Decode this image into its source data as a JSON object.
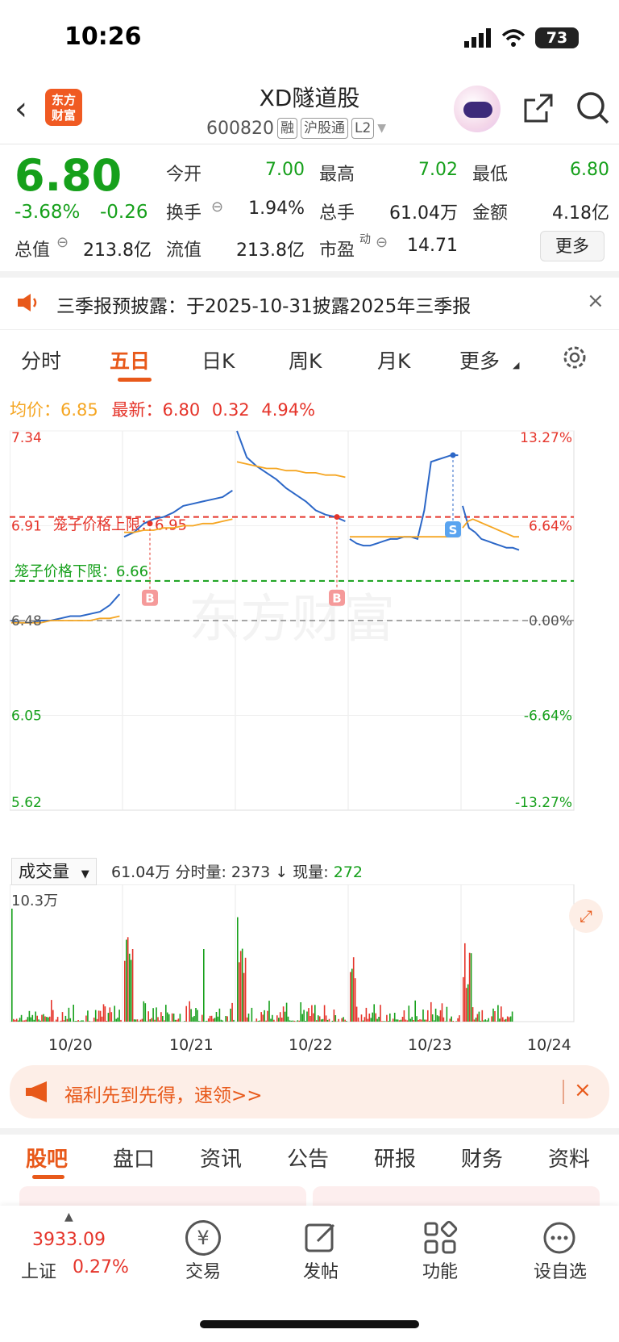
{
  "status": {
    "time": "10:26",
    "battery": "73"
  },
  "header": {
    "title": "XD隧道股",
    "code": "600820",
    "tags": [
      "融",
      "沪股通",
      "L2"
    ],
    "logo_text": "东方财富"
  },
  "quote": {
    "price": "6.80",
    "change_pct": "-3.68%",
    "change": "-0.26",
    "rows": [
      [
        {
          "label": "今开",
          "value": "7.00",
          "color": "green"
        },
        {
          "label": "最高",
          "value": "7.02",
          "color": "green"
        },
        {
          "label": "最低",
          "value": "6.80",
          "color": "green"
        }
      ],
      [
        {
          "label": "换手",
          "value": "1.94%",
          "color": "black"
        },
        {
          "label": "总手",
          "value": "61.04万",
          "color": "black"
        },
        {
          "label": "金额",
          "value": "4.18亿",
          "color": "black"
        }
      ],
      [
        {
          "label": "总值",
          "value": "213.8亿",
          "color": "black"
        },
        {
          "label": "流值",
          "value": "213.8亿",
          "color": "black"
        },
        {
          "label": "市盈",
          "value": "14.71",
          "color": "black"
        }
      ]
    ],
    "pe_sup": "动",
    "more_label": "更多"
  },
  "notice": {
    "text": "三季报预披露：于2025-10-31披露2025年三季报",
    "close": "×"
  },
  "tabs": {
    "items": [
      "分时",
      "五日",
      "日K",
      "周K",
      "月K",
      "更多"
    ],
    "active": 1
  },
  "legend": {
    "avg_label": "均价：",
    "avg_value": "6.85",
    "latest_label": "最新：",
    "latest_value": "6.80",
    "latest_chg": "0.32",
    "latest_pct": "4.94%"
  },
  "chart_data": {
    "type": "line",
    "title": "",
    "x": [
      "10/20",
      "10/21",
      "10/22",
      "10/23",
      "10/24"
    ],
    "xlabel": "",
    "ylabel": "",
    "ylim": [
      5.62,
      7.34
    ],
    "left_ticks": [
      "7.34",
      "6.91",
      "6.48",
      "6.05",
      "5.62"
    ],
    "right_ticks": [
      "13.27%",
      "6.64%",
      "0.00%",
      "-6.64%",
      "-13.27%"
    ],
    "reference_lines": [
      {
        "label": "笼子价格上限：6.95",
        "value": 6.95,
        "color": "#e5342a"
      },
      {
        "label": "笼子价格下限：6.66",
        "value": 6.66,
        "color": "#16a01b"
      },
      {
        "label": "",
        "value": 6.48,
        "color": "#888888"
      }
    ],
    "markers": [
      {
        "label": "B",
        "day": 1,
        "price": 6.92
      },
      {
        "label": "B",
        "day": 3,
        "price": 6.95
      },
      {
        "label": "S",
        "day": 4,
        "price": 7.23
      }
    ],
    "series": [
      {
        "name": "价格",
        "color": "#2c67c7",
        "days": [
          [
            6.48,
            6.47,
            6.47,
            6.48,
            6.48,
            6.49,
            6.5,
            6.5,
            6.51,
            6.52,
            6.55,
            6.6
          ],
          [
            6.86,
            6.88,
            6.92,
            6.94,
            6.95,
            6.97,
            7.0,
            7.01,
            7.02,
            7.03,
            7.04,
            7.07
          ],
          [
            7.34,
            7.22,
            7.18,
            7.15,
            7.12,
            7.08,
            7.05,
            7.02,
            6.98,
            6.96,
            6.95,
            6.93
          ],
          [
            6.85,
            6.83,
            6.82,
            6.82,
            6.83,
            6.84,
            6.85,
            6.85,
            6.86,
            6.86,
            6.85,
            6.98,
            7.2,
            7.21,
            7.22,
            7.23,
            7.23
          ],
          [
            7.0,
            6.9,
            6.88,
            6.85,
            6.84,
            6.83,
            6.82,
            6.81,
            6.81,
            6.8
          ]
        ]
      },
      {
        "name": "均价",
        "color": "#f5a623",
        "days": [
          [
            6.47,
            6.47,
            6.47,
            6.47,
            6.48,
            6.48,
            6.48,
            6.48,
            6.48,
            6.49,
            6.49,
            6.5
          ],
          [
            6.88,
            6.88,
            6.89,
            6.89,
            6.9,
            6.9,
            6.91,
            6.91,
            6.92,
            6.92,
            6.93,
            6.94
          ],
          [
            7.2,
            7.19,
            7.18,
            7.17,
            7.17,
            7.16,
            7.16,
            7.15,
            7.15,
            7.14,
            7.14,
            7.13
          ],
          [
            6.86,
            6.86,
            6.86,
            6.86,
            6.86,
            6.86,
            6.86,
            6.86,
            6.86,
            6.86,
            6.86,
            6.86
          ],
          [
            6.9,
            6.93,
            6.94,
            6.93,
            6.92,
            6.91,
            6.9,
            6.89,
            6.88,
            6.87,
            6.86,
            6.86
          ]
        ]
      }
    ]
  },
  "volume": {
    "selector": "成交量",
    "total": "61.04万",
    "tick_label": "分时量:",
    "tick_value": "2373",
    "arrow": "↓",
    "now_label": "现量:",
    "now_value": "272",
    "max_label": "10.3万",
    "expand_icon": "expand-icon"
  },
  "dates": [
    "10/20",
    "10/21",
    "10/22",
    "10/23",
    "10/24"
  ],
  "promo": {
    "text": "福利先到先得，速领>>",
    "close": "×"
  },
  "bottom_tabs": {
    "items": [
      "股吧",
      "盘口",
      "资讯",
      "公告",
      "研报",
      "财务",
      "资料"
    ],
    "active": 0
  },
  "footer": {
    "index_value": "3933.09",
    "index_name": "上证",
    "index_pct": "0.27%",
    "items": [
      {
        "label": "交易",
        "icon": "yen-icon"
      },
      {
        "label": "发帖",
        "icon": "edit-icon"
      },
      {
        "label": "功能",
        "icon": "grid-icon"
      },
      {
        "label": "设自选",
        "icon": "more-icon"
      }
    ]
  },
  "colors": {
    "up": "#e5342a",
    "down": "#16a01b",
    "accent": "#e8591a",
    "price_line": "#2c67c7",
    "avg_line": "#f5a623"
  }
}
